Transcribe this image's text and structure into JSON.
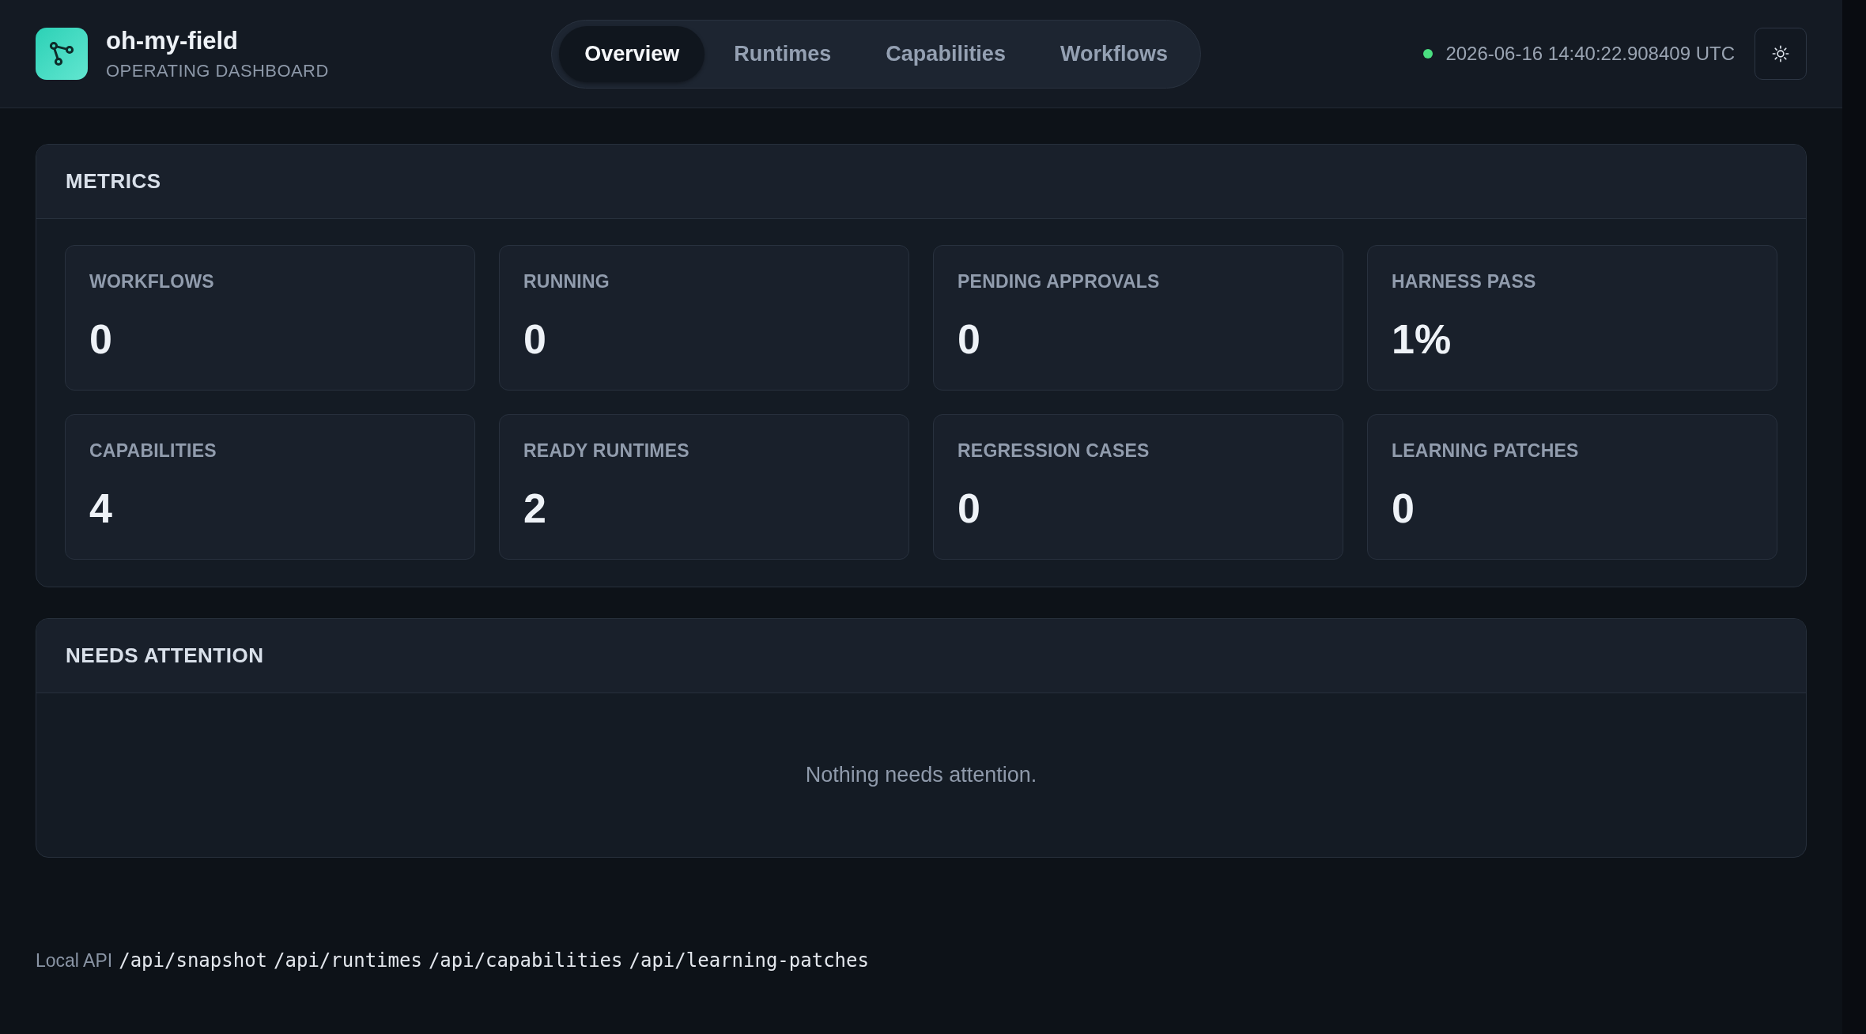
{
  "brand": {
    "name": "oh-my-field",
    "subtitle": "OPERATING DASHBOARD"
  },
  "nav": {
    "tabs": [
      {
        "label": "Overview",
        "selected": true
      },
      {
        "label": "Runtimes",
        "selected": false
      },
      {
        "label": "Capabilities",
        "selected": false
      },
      {
        "label": "Workflows",
        "selected": false
      }
    ]
  },
  "status": {
    "online": true,
    "timestamp": "2026-06-16 14:40:22.908409 UTC"
  },
  "metrics": {
    "title": "METRICS",
    "items": [
      {
        "label": "WORKFLOWS",
        "value": "0"
      },
      {
        "label": "RUNNING",
        "value": "0"
      },
      {
        "label": "PENDING APPROVALS",
        "value": "0"
      },
      {
        "label": "HARNESS PASS",
        "value": "1%"
      },
      {
        "label": "CAPABILITIES",
        "value": "4"
      },
      {
        "label": "READY RUNTIMES",
        "value": "2"
      },
      {
        "label": "REGRESSION CASES",
        "value": "0"
      },
      {
        "label": "LEARNING PATCHES",
        "value": "0"
      }
    ]
  },
  "attention": {
    "title": "NEEDS ATTENTION",
    "empty_text": "Nothing needs attention."
  },
  "footer": {
    "label": "Local API",
    "endpoints": [
      "/api/snapshot",
      "/api/runtimes",
      "/api/capabilities",
      "/api/learning-patches"
    ]
  }
}
